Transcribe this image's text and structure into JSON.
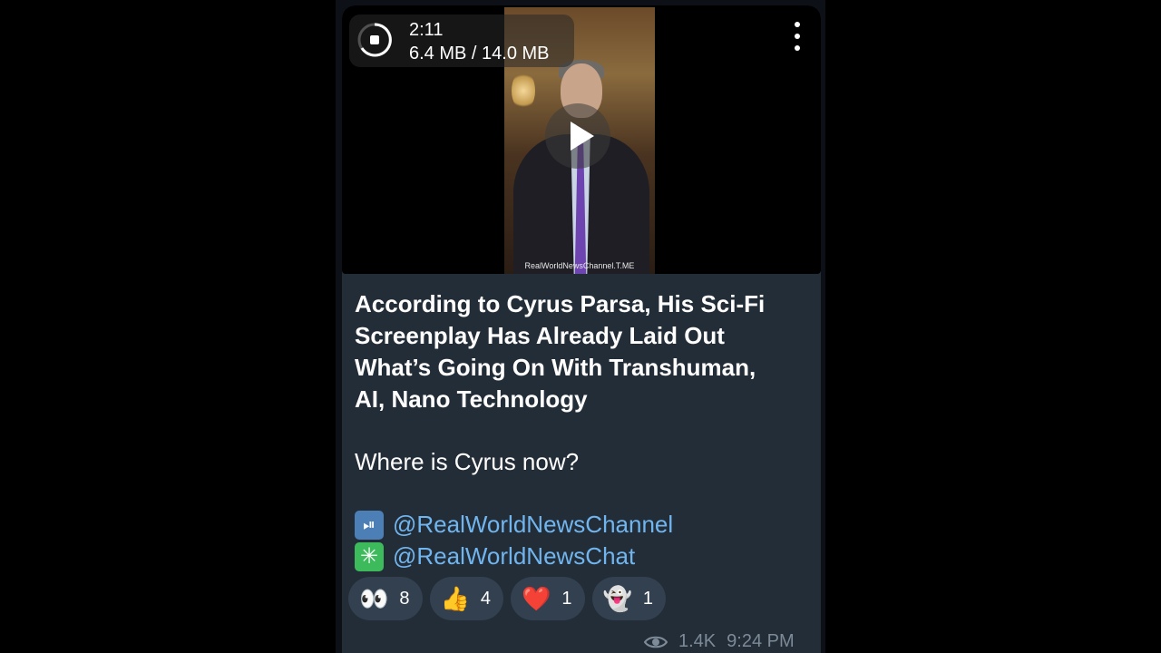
{
  "video": {
    "duration": "2:11",
    "download_progress": "6.4 MB / 14.0 MB",
    "watermark": "RealWorldNewsChannel.T.ME"
  },
  "message": {
    "title": "According to Cyrus Parsa, His Sci-Fi Screenplay Has Already Laid Out What’s Going On With Transhuman, AI, Nano Technology",
    "question": "Where is Cyrus now?",
    "links": [
      {
        "icon": "play-pause-icon",
        "icon_glyph": "⏯",
        "text": "@RealWorldNewsChannel"
      },
      {
        "icon": "asterisk-icon",
        "icon_glyph": "✳",
        "text": "@RealWorldNewsChat"
      }
    ]
  },
  "reactions": [
    {
      "emoji": "👀",
      "count": "8"
    },
    {
      "emoji": "👍",
      "count": "4"
    },
    {
      "emoji": "❤️",
      "count": "1"
    },
    {
      "emoji": "👻",
      "count": "1"
    }
  ],
  "meta": {
    "views": "1.4K",
    "time": "9:24 PM"
  },
  "colors": {
    "bubble": "#232d38",
    "link": "#71b5ef",
    "chip": "#33404f"
  }
}
